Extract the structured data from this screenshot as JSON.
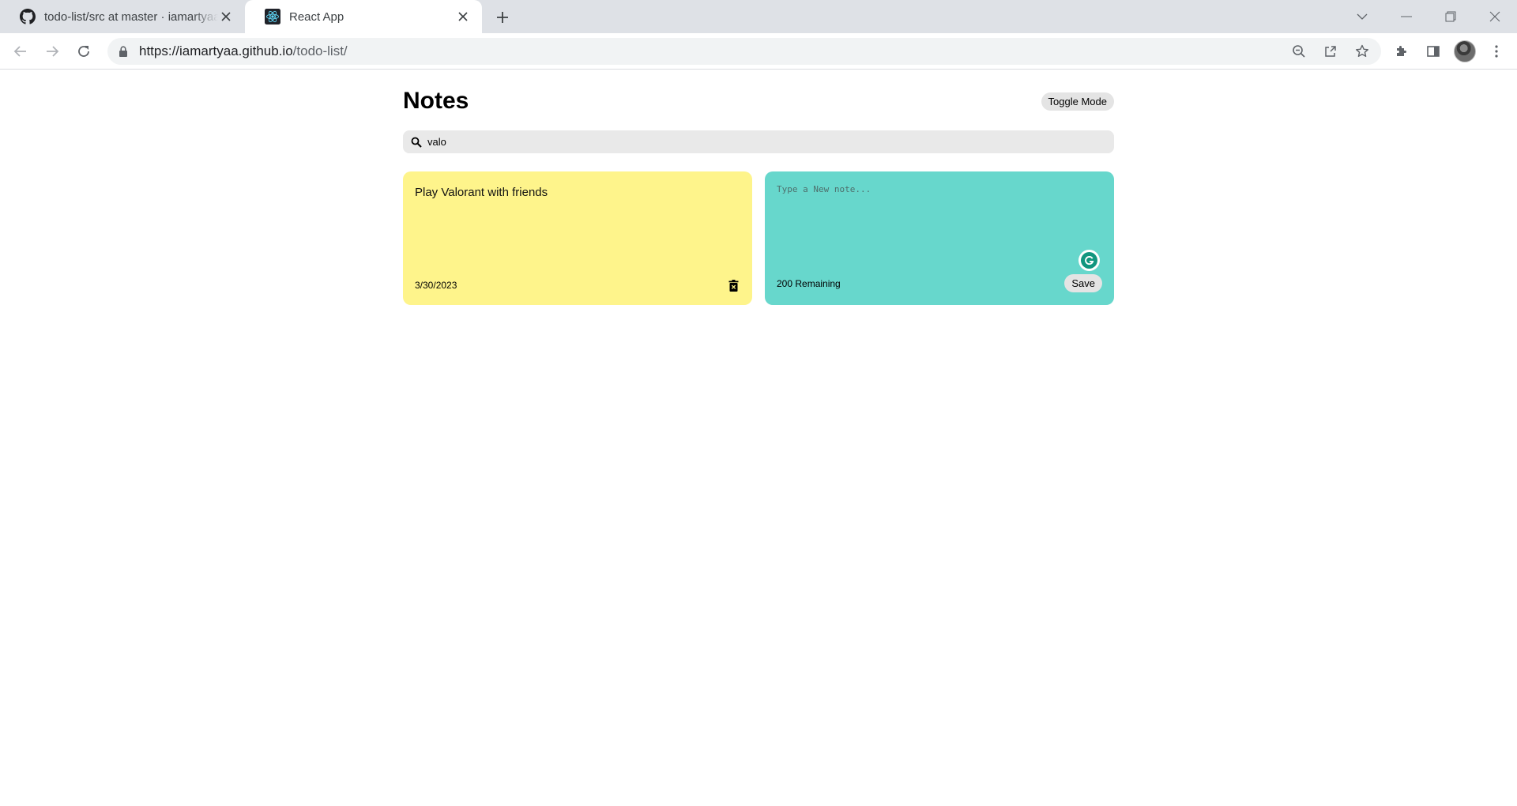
{
  "browser": {
    "tabs": [
      {
        "title": "todo-list/src at master · iamartyaa",
        "icon": "github-icon",
        "active": false
      },
      {
        "title": "React App",
        "icon": "react-icon",
        "active": true
      }
    ],
    "address": {
      "host": "https://iamartyaa.github.io",
      "path": "/todo-list/"
    }
  },
  "app": {
    "title": "Notes",
    "toggle_label": "Toggle Mode",
    "search": {
      "value": "valo",
      "icon": "search-icon"
    },
    "notes": [
      {
        "text": "Play Valorant with friends",
        "date": "3/30/2023",
        "color": "#fef48b"
      }
    ],
    "new_note": {
      "placeholder": "Type a New note...",
      "remaining": "200 Remaining",
      "save_label": "Save",
      "color": "#67d7cc"
    }
  }
}
